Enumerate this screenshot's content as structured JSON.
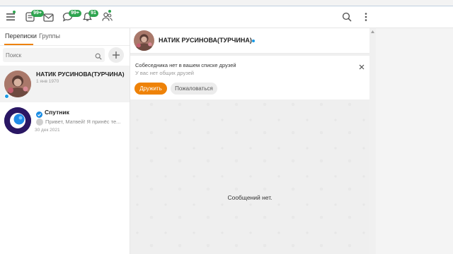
{
  "topbar": {
    "badges": {
      "notes": "99+",
      "chats": "99+",
      "notifications": "91"
    },
    "colors": {
      "accent": "#ee8208",
      "badge": "#2ea44f",
      "online": "#1a9be6"
    },
    "icons": [
      "menu-icon",
      "notes-icon",
      "mail-icon",
      "chat-bubble-icon",
      "bell-icon",
      "friends-icon",
      "search-icon",
      "more-vertical-icon"
    ]
  },
  "sidebar": {
    "tabs": [
      {
        "label": "Переписки",
        "active": true
      },
      {
        "label": "Группы",
        "active": false
      }
    ],
    "search_placeholder": "Поиск",
    "chats": [
      {
        "name": "НАТИК РУСИНОВА(ТУРЧИНА)",
        "date": "1 янв 1970",
        "preview": "",
        "selected": true,
        "online": true
      },
      {
        "name": "Спутник",
        "date": "30 дек 2021",
        "preview": "Привет, Матвей! Я принёс те...",
        "verified": true
      }
    ]
  },
  "chat": {
    "header_name": "НАТИК РУСИНОВА(ТУРЧИНА)",
    "notice_title": "Собеседника нет в вашем списке друзей",
    "notice_sub": "У вас нет общих друзей",
    "add_friend_label": "Дружить",
    "report_label": "Пожаловаться",
    "empty_text": "Сообщений нет."
  }
}
